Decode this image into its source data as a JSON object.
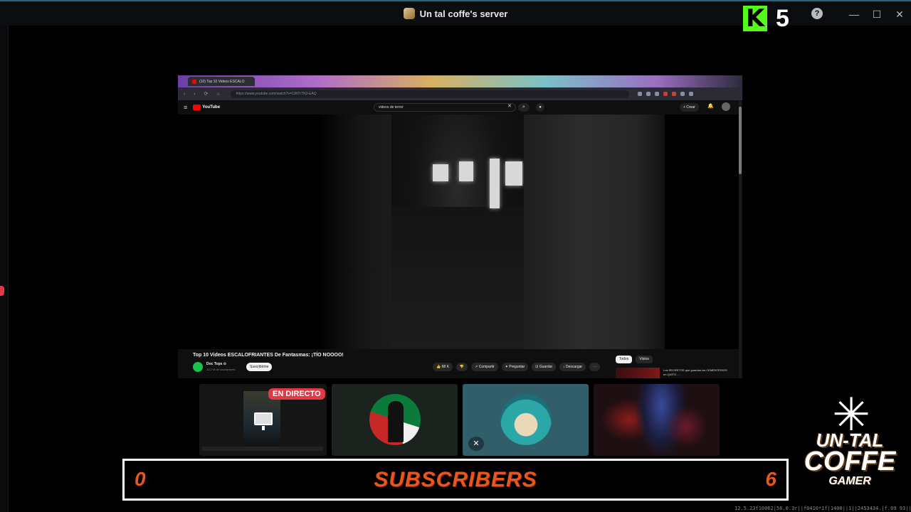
{
  "window": {
    "title": "Un tal coffe's server",
    "controls": {
      "minimize": "—",
      "maximize": "☐",
      "close": "✕"
    },
    "help": "?"
  },
  "overlay": {
    "kick_letter": "K",
    "kick_count": "5"
  },
  "browser": {
    "tab_title": "(10) Top 10 Videos ESCALO",
    "url": "https://www.youtube.com/watch?v=CtNTrTN3-EAQ",
    "nav": "‹ › ⟳ ⌂"
  },
  "youtube": {
    "logo": "YouTube",
    "search_value": "videos de terror",
    "create_label": "+ Crear",
    "video_title": "Top 10 Videos ESCALOFRIANTES De Fantasmas: ¡TÍO NOOOO!",
    "channel_name": "Doc Tops ⊙",
    "channel_subs": "12,2 M de suscriptores",
    "subscribe_label": "Suscribirme",
    "actions": [
      "👍 68 K",
      "👎",
      "↗ Compartir",
      "✦ Preguntar",
      "⊡ Guardar",
      "↓ Descargar",
      "⋯"
    ],
    "chips": [
      "Todos",
      "Vistos"
    ],
    "rec_title": "Los SECRETOS que guardan los CEMENTERIOS en QUITO ..."
  },
  "participants": {
    "live_badge": "EN DIRECTO"
  },
  "subscribers": {
    "left": "0",
    "label": "SUBSCRIBERS",
    "right": "6"
  },
  "logo": {
    "line1": "UN-TAL",
    "line2": "COFFE",
    "line3": "GAMER"
  },
  "footer_text": "12.5.23f10062|56.0.3r||f0410*1f|1400||1||2453434.|f.09 93||0001221131",
  "colors": {
    "accent": "#e8561e",
    "live": "#e03a48",
    "kick": "#53fc18"
  }
}
